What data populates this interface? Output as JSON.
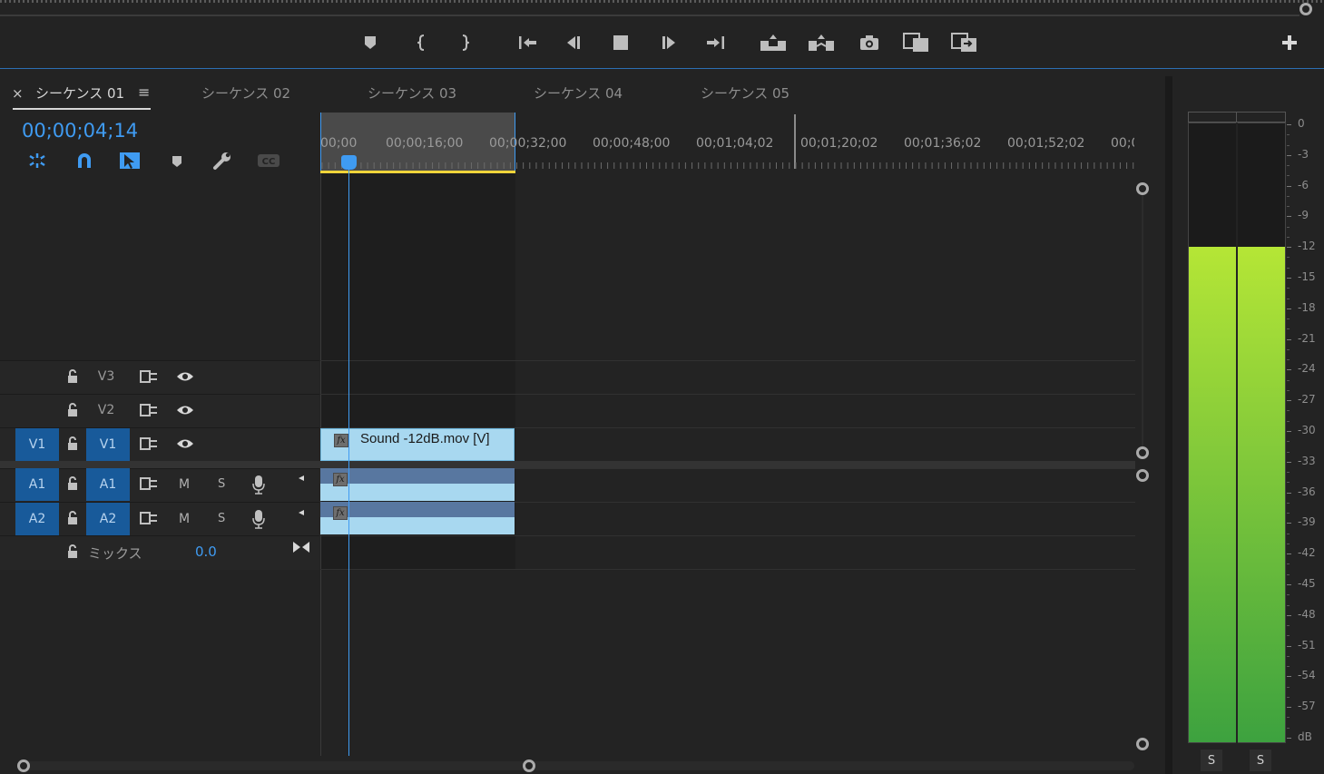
{
  "tabs": [
    {
      "label": "シーケンス 01",
      "active": true
    },
    {
      "label": "シーケンス 02",
      "active": false
    },
    {
      "label": "シーケンス 03",
      "active": false
    },
    {
      "label": "シーケンス 04",
      "active": false
    },
    {
      "label": "シーケンス 05",
      "active": false
    }
  ],
  "close_glyph": "×",
  "menu_glyph": "≡",
  "timecode": "00;00;04;14",
  "ruler": {
    "ticks": [
      "00;00",
      "00;00;16;00",
      "00;00;32;00",
      "00;00;48;00",
      "00;01;04;02",
      "00;01;20;02",
      "00;01;36;02",
      "00;01;52;02",
      "00;0"
    ]
  },
  "tracks": {
    "video": [
      {
        "id": "V3",
        "source_target": "",
        "target": "V3",
        "toggle_glyph": "⊟"
      },
      {
        "id": "V2",
        "source_target": "",
        "target": "V2"
      },
      {
        "id": "V1",
        "source_target": "V1",
        "target": "V1"
      }
    ],
    "audio": [
      {
        "id": "A1",
        "source_target": "A1",
        "target": "A1",
        "mute": "M",
        "solo": "S"
      },
      {
        "id": "A2",
        "source_target": "A2",
        "target": "A2",
        "mute": "M",
        "solo": "S"
      }
    ],
    "mix": {
      "label": "ミックス",
      "value": "0.0"
    }
  },
  "clips": {
    "video_clip_name": "Sound -12dB.mov [V]",
    "fx_label": "fx"
  },
  "meter": {
    "scale": [
      "0",
      "-3",
      "-6",
      "-9",
      "-12",
      "-15",
      "-18",
      "-21",
      "-24",
      "-27",
      "-30",
      "-33",
      "-36",
      "-39",
      "-42",
      "-45",
      "-48",
      "-51",
      "-54",
      "-57",
      "dB"
    ],
    "level_db": -12,
    "solo_left": "S",
    "solo_right": "S",
    "gradient_top": "#b5e636",
    "gradient_bottom": "#3da23f"
  },
  "colors": {
    "accent": "#3f9bf2",
    "track_target": "#185a9a",
    "clip": "#a8d8f0",
    "work_area": "#f0d43a"
  }
}
